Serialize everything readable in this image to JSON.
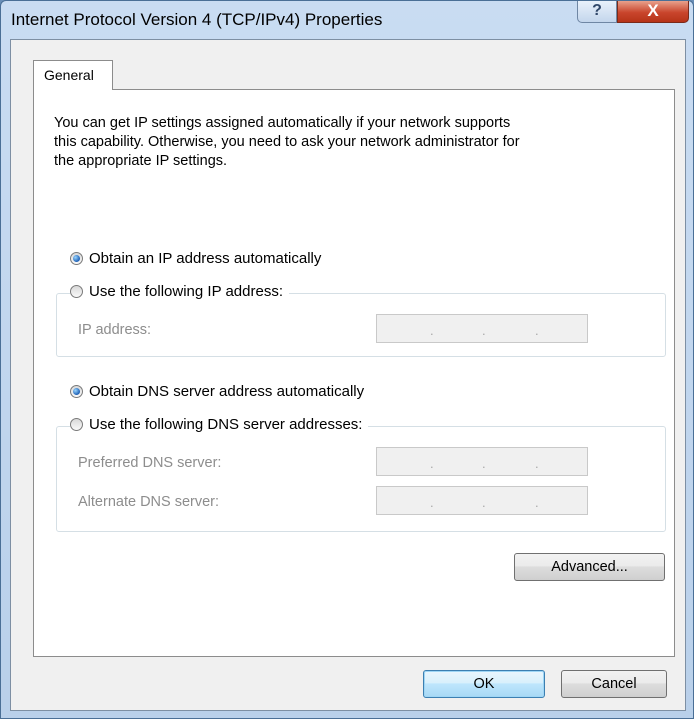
{
  "window": {
    "title": "Internet Protocol Version 4 (TCP/IPv4) Properties"
  },
  "titlebar": {
    "help_glyph": "?",
    "close_glyph": "X"
  },
  "tabs": [
    {
      "label": "General"
    }
  ],
  "general": {
    "description_lines": [
      "You can get IP settings assigned automatically if your network supports",
      "this capability. Otherwise, you need to ask your network administrator for",
      "the appropriate IP settings."
    ],
    "ip": {
      "auto_label": "Obtain an IP address automatically",
      "auto_selected": true,
      "manual_label": "Use the following IP address:",
      "manual_selected": false,
      "fields": [
        {
          "label": "IP address:",
          "value": ". . ."
        }
      ]
    },
    "dns": {
      "auto_label": "Obtain DNS server address automatically",
      "auto_selected": true,
      "manual_label": "Use the following DNS server addresses:",
      "manual_selected": false,
      "fields": [
        {
          "label": "Preferred DNS server:",
          "value": ". . ."
        },
        {
          "label": "Alternate DNS server:",
          "value": ". . ."
        }
      ]
    },
    "advanced_label": "Advanced..."
  },
  "footer": {
    "ok_label": "OK",
    "cancel_label": "Cancel"
  },
  "colors": {
    "selected_radio": "#1d5fb5",
    "disabled_text": "#8d8d8d",
    "close_button": "#c9452c"
  }
}
